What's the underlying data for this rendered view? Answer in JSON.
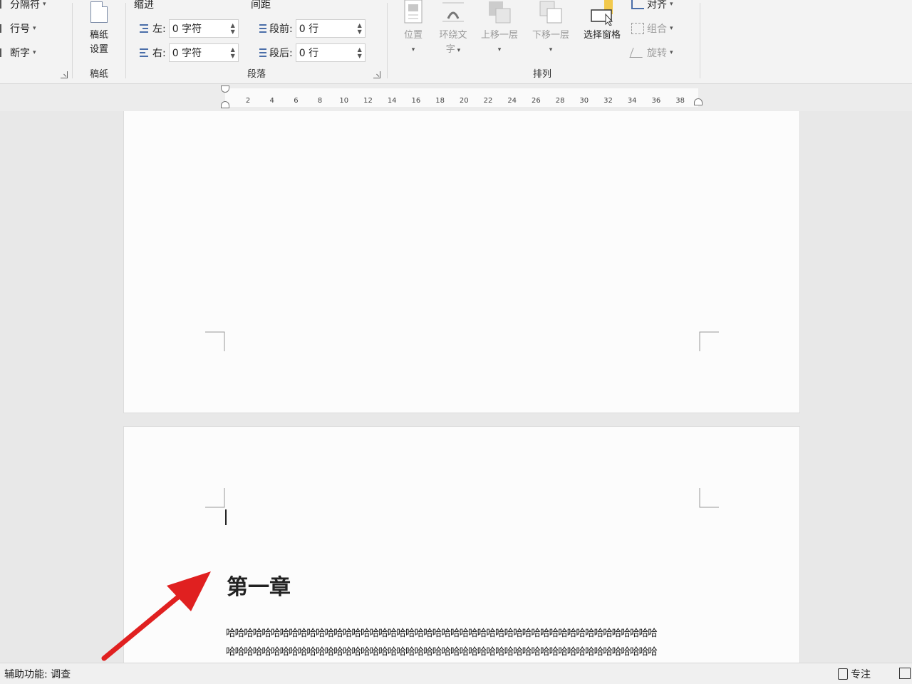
{
  "page_layout": {
    "items": [
      {
        "label": "分隔符"
      },
      {
        "label": "行号"
      },
      {
        "label": "断字"
      }
    ]
  },
  "manuscript": {
    "button_label_1": "稿纸",
    "button_label_2": "设置",
    "group_label": "稿纸"
  },
  "paragraph": {
    "indent_title": "缩进",
    "spacing_title": "间距",
    "left_label": "左:",
    "right_label": "右:",
    "left_value": "0 字符",
    "right_value": "0 字符",
    "before_label": "段前:",
    "after_label": "段后:",
    "before_value": "0 行",
    "after_value": "0 行",
    "group_label": "段落"
  },
  "arrange": {
    "position_label": "位置",
    "wrap_label_1": "环绕文",
    "wrap_label_2": "字",
    "forward_label": "上移一层",
    "backward_label": "下移一层",
    "selection_pane_label": "选择窗格",
    "align_label": "对齐",
    "group_label_btn": "组合",
    "rotate_label": "旋转",
    "group_label": "排列"
  },
  "ruler": {
    "ticks": [
      "2",
      "4",
      "6",
      "8",
      "10",
      "12",
      "14",
      "16",
      "18",
      "20",
      "22",
      "24",
      "26",
      "28",
      "30",
      "32",
      "34",
      "36",
      "38"
    ]
  },
  "document": {
    "heading": "第一章",
    "line1": "哈哈哈哈哈哈哈哈哈哈哈哈哈哈哈哈哈哈哈哈哈哈哈哈哈哈哈哈哈哈哈哈哈哈哈哈哈哈哈哈哈哈哈哈哈哈哈哈",
    "line2": "哈哈哈哈哈哈哈哈哈哈哈哈哈哈哈哈哈哈哈哈哈哈哈哈哈哈哈哈哈哈哈哈哈哈哈哈哈哈哈哈哈哈哈哈哈哈哈哈"
  },
  "status": {
    "accessibility": "辅助功能: 调查",
    "focus": "专注"
  },
  "colors": {
    "annotation_arrow": "#e02020",
    "selection_pane_accent": "#f2c94c"
  }
}
